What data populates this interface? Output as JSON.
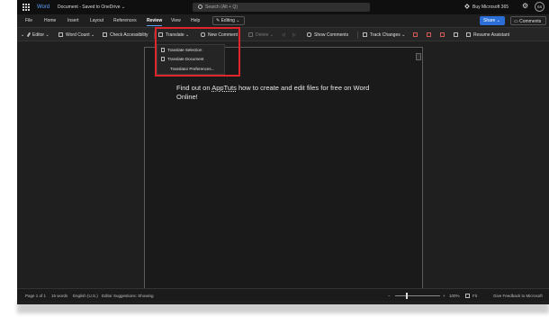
{
  "titlebar": {
    "app_name": "Word",
    "doc_title": "Document - Saved to OneDrive ⌄",
    "search_placeholder": "Search (Alt + Q)",
    "buy_label": "Buy Microsoft 365",
    "avatar_initials": "SS"
  },
  "menu": {
    "items": [
      "File",
      "Home",
      "Insert",
      "Layout",
      "References",
      "Review",
      "View",
      "Help"
    ],
    "active": "Review",
    "editing_label": "Editing ⌄",
    "share_label": "Share ⌄",
    "comments_label": "Comments"
  },
  "ribbon": {
    "editor": "Editor ⌄",
    "word_count": "Word Count ⌄",
    "check_accessibility": "Check Accessibility",
    "translate": "Translate ⌄",
    "new_comment": "New Comment",
    "delete": "Delete ⌄",
    "show_comments": "Show Comments",
    "track_changes": "Track Changes ⌄",
    "resume_assistant": "Resume Assistant"
  },
  "translate_menu": {
    "items": [
      "Translate Selection",
      "Translate Document",
      "Translator Preferences..."
    ]
  },
  "document": {
    "text_before": "Find out on ",
    "link": "AppTuts",
    "text_after": " how to create and edit files for free on Word Online!"
  },
  "statusbar": {
    "page": "Page 1 of 1",
    "words": "15 words",
    "language": "English (U.S.)",
    "suggestions": "Editor Suggestions: Showing",
    "zoom": "100%",
    "fit": "Fit",
    "feedback": "Give Feedback to Microsoft"
  },
  "colors": {
    "accent": "#2b6fd6",
    "highlight": "#e0252b"
  }
}
